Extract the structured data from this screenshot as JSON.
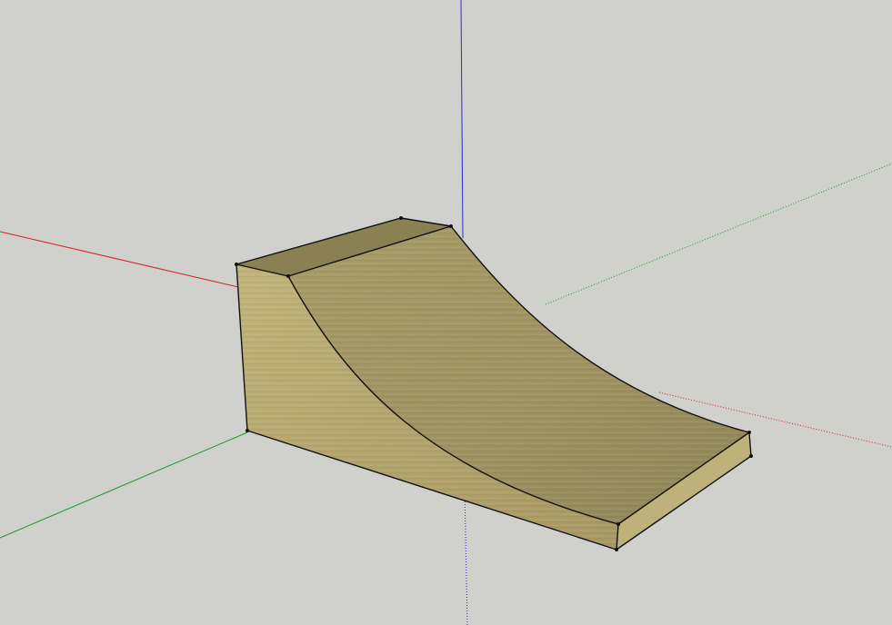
{
  "scene": {
    "background_color": "#d0d0cc",
    "axes": {
      "red": "#d2232a",
      "green": "#1a9b2a",
      "blue": "#2b2bd6"
    },
    "model": {
      "name": "quarter-pipe-ramp",
      "material_top": "#8c8355",
      "material_side": "#b5a66f",
      "material_curve": "#a39866",
      "edge_color": "#111111"
    }
  }
}
